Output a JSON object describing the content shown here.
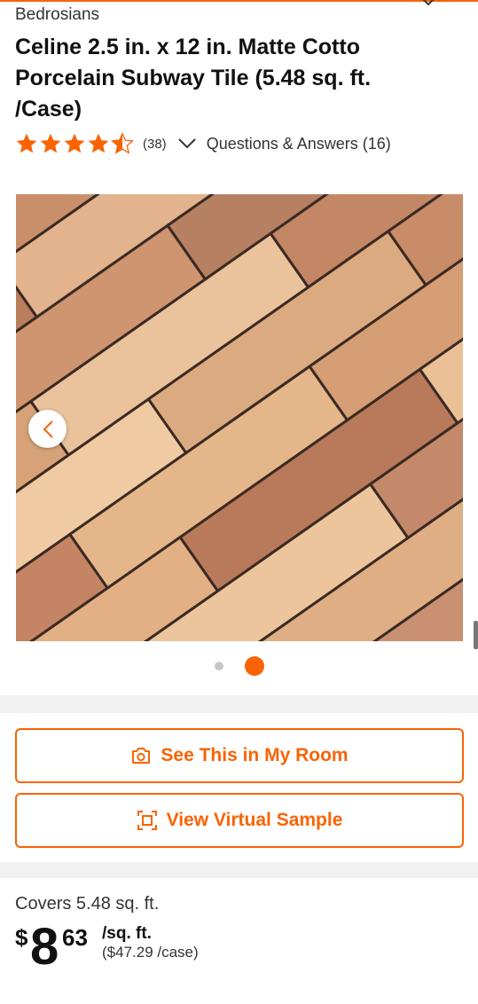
{
  "product": {
    "brand": "Bedrosians",
    "title": "Celine 2.5 in. x 12 in. Matte Cotto Porcelain Subway Tile (5.48 sq. ft. /Case)",
    "rating": 4.5,
    "review_count": "(38)",
    "qa_label": "Questions & Answers (16)"
  },
  "gallery": {
    "image_description_icon": "tile-photo",
    "prev_icon": "chevron-left-icon",
    "dots": [
      {
        "active": false
      },
      {
        "active": true
      }
    ]
  },
  "actions": {
    "see_in_room_label": "See This in My Room",
    "virtual_sample_label": "View Virtual Sample"
  },
  "pricing": {
    "coverage": "Covers 5.48 sq. ft.",
    "currency": "$",
    "whole": "8",
    "cents": "63",
    "unit": "/sq. ft.",
    "per_case": "($47.29 /case)"
  },
  "colors": {
    "accent": "#f96302",
    "star": "#f96302"
  }
}
